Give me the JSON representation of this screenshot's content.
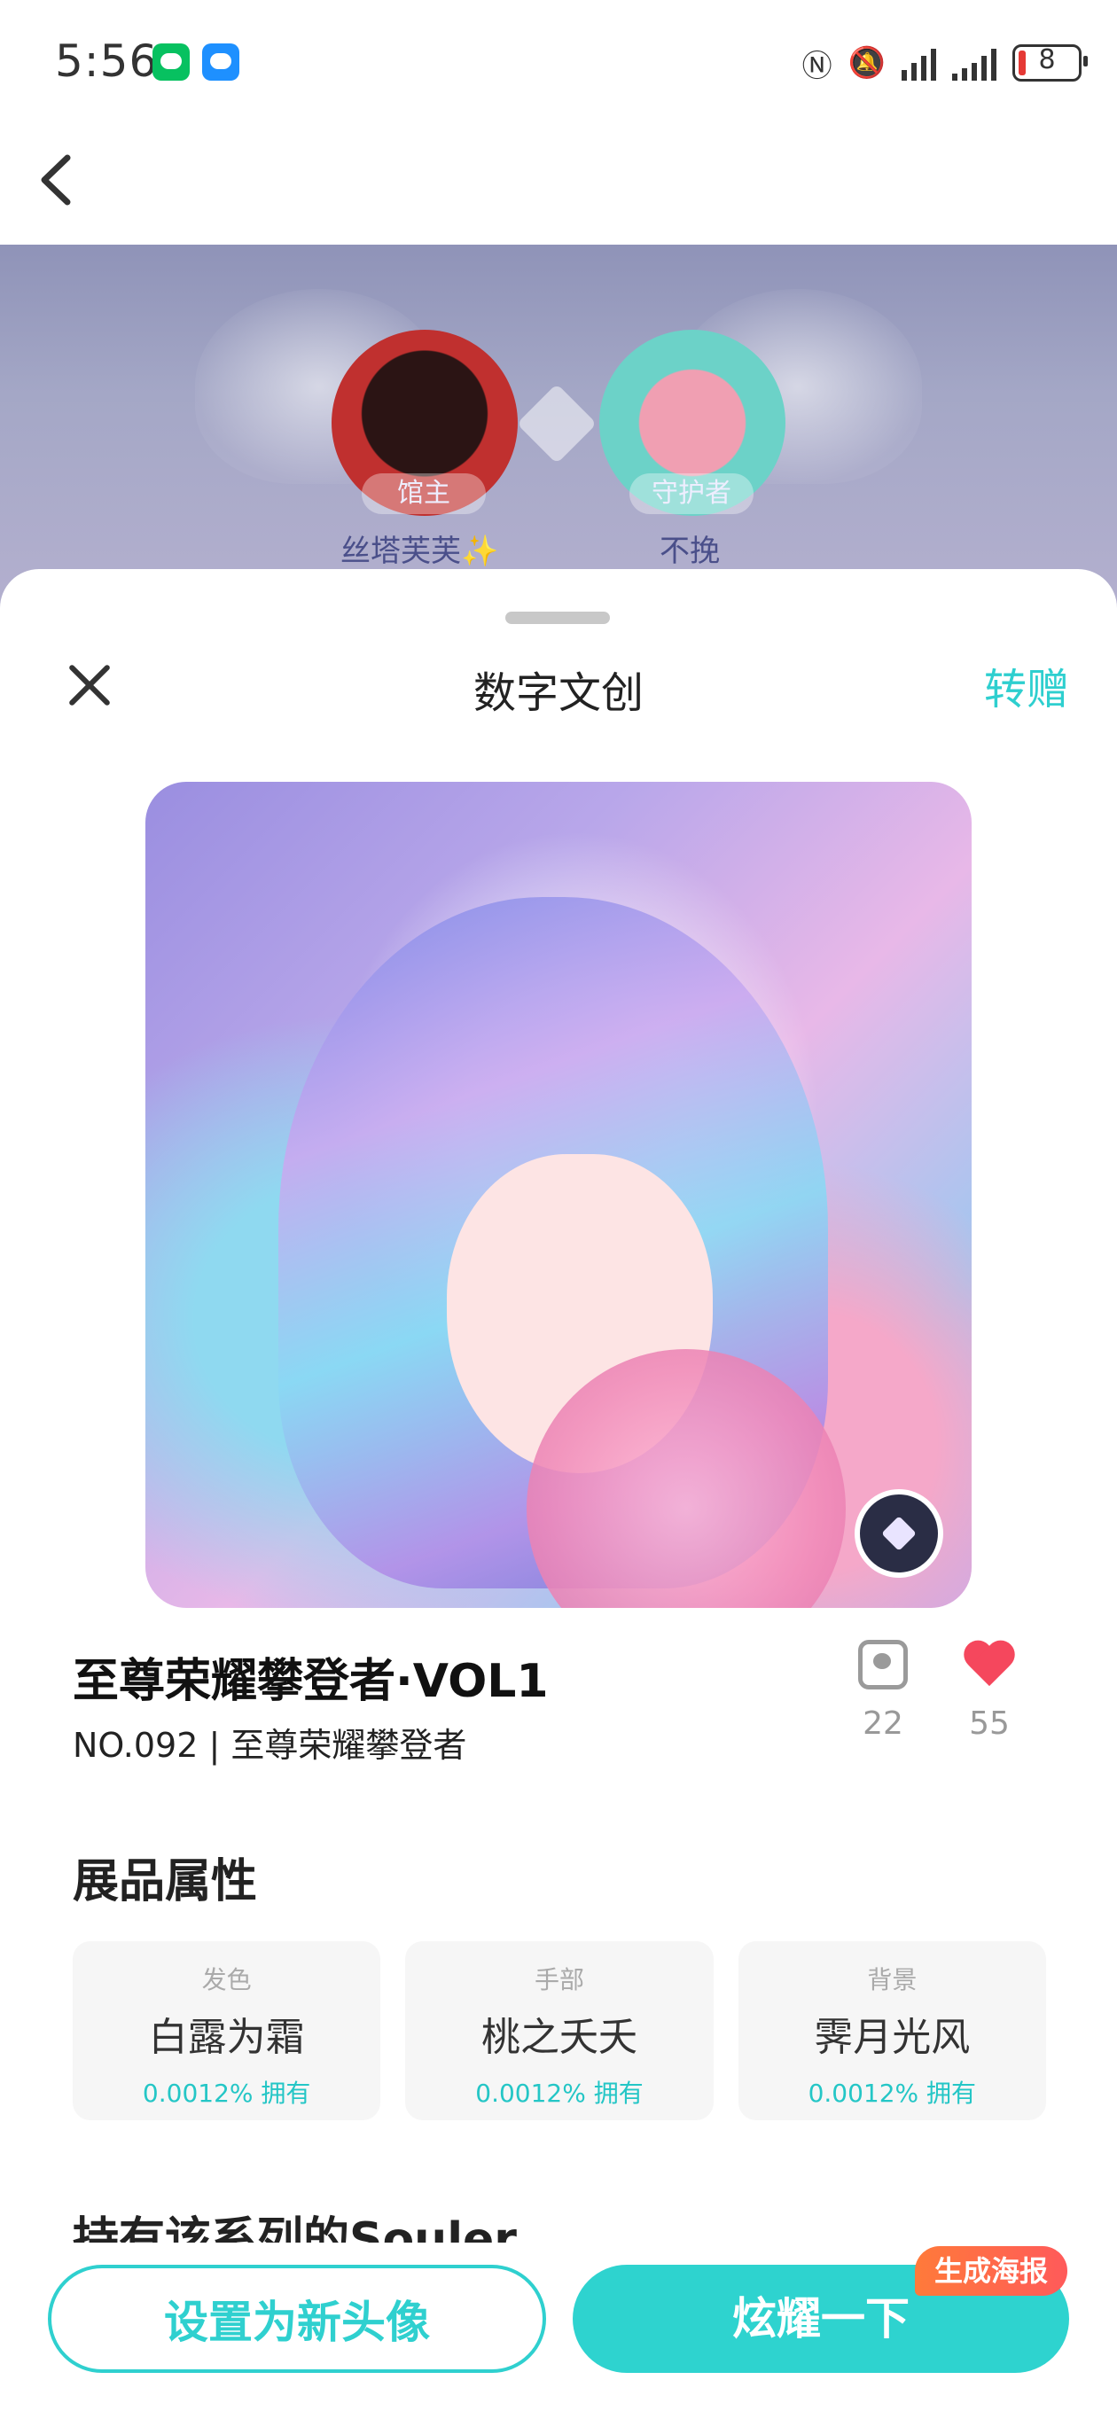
{
  "status_bar": {
    "time": "5:56",
    "battery": "8"
  },
  "hero": {
    "owner": {
      "role": "馆主",
      "name": "丝塔芙芙✨"
    },
    "guardian": {
      "role": "守护者",
      "name": "不挽"
    }
  },
  "sheet": {
    "title": "数字文创",
    "gift_label": "转赠",
    "item": {
      "title": "至尊荣耀攀登者·VOL1",
      "subtitle": "NO.092 | 至尊荣耀攀登者",
      "collect_count": "22",
      "like_count": "55"
    },
    "attributes_title": "展品属性",
    "attributes": [
      {
        "key": "发色",
        "value": "白露为霜",
        "pct": "0.0012% 拥有"
      },
      {
        "key": "手部",
        "value": "桃之夭夭",
        "pct": "0.0012% 拥有"
      },
      {
        "key": "背景",
        "value": "霁月光风",
        "pct": "0.0012% 拥有"
      }
    ],
    "owners_title": "持有该系列的Souler"
  },
  "actions": {
    "set_avatar": "设置为新头像",
    "show_off": "炫耀一下",
    "poster_tag": "生成海报"
  },
  "colors": {
    "accent": "#2ed3cf",
    "heart": "#f5475d",
    "poster": "#ff6a45"
  }
}
